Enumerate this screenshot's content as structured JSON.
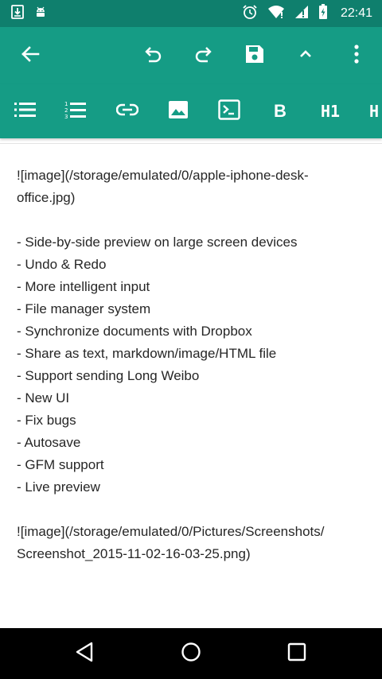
{
  "status_bar": {
    "time": "22:41",
    "icons": [
      "download-icon",
      "android-debug-icon",
      "alarm-icon",
      "wifi-icon",
      "signal-icon",
      "battery-icon"
    ]
  },
  "toolbar": {
    "icons": [
      "back-arrow-icon",
      "undo-icon",
      "redo-icon",
      "save-icon",
      "chevron-up-icon",
      "more-vert-icon"
    ]
  },
  "format_bar": {
    "icons": [
      "bulleted-list-icon",
      "numbered-list-icon",
      "link-icon",
      "image-icon",
      "code-icon"
    ],
    "bold_label": "B",
    "h1_label": "H1",
    "h2_partial_label": "H"
  },
  "editor": {
    "lines": [
      "![image](/storage/emulated/0/apple-iphone-desk-",
      "office.jpg)",
      "",
      "- Side-by-side preview on large screen devices",
      "- Undo & Redo",
      "- More intelligent input",
      "- File manager system",
      "- Synchronize documents with Dropbox",
      "- Share as text, markdown/image/HTML file",
      "- Support sending Long Weibo",
      "- New UI",
      "- Fix bugs",
      "- Autosave",
      "- GFM support",
      "- Live preview",
      "",
      "![image](/storage/emulated/0/Pictures/Screenshots/",
      "Screenshot_2015-11-02-16-03-25.png)"
    ]
  },
  "nav_bar": {
    "icons": [
      "back-triangle-icon",
      "home-circle-icon",
      "recents-square-icon"
    ]
  },
  "colors": {
    "status_bar": "#0f7f6d",
    "toolbar": "#159c85",
    "text": "#262626",
    "nav_bar": "#000000"
  }
}
